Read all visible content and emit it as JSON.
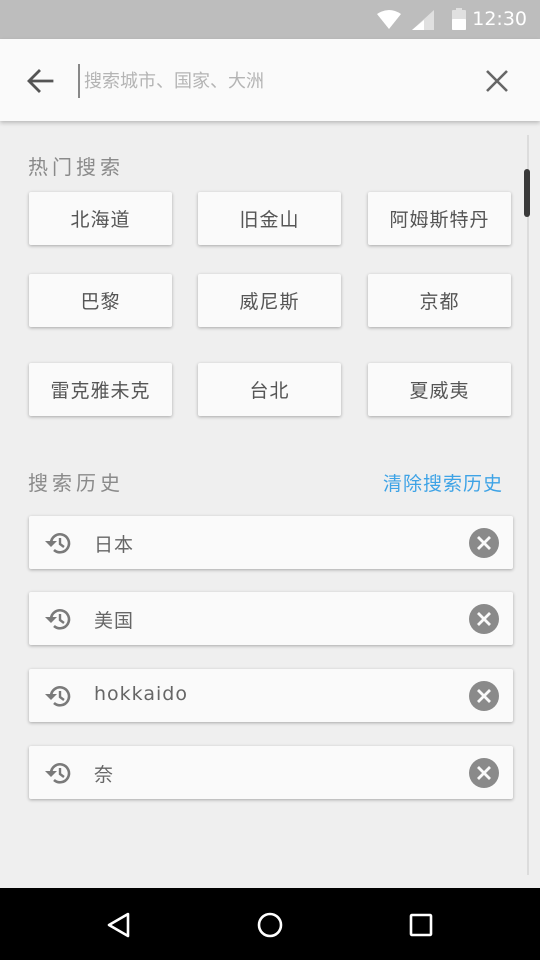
{
  "status_bar": {
    "time": "12:30",
    "icons": [
      "wifi-icon",
      "signal-icon",
      "battery-icon"
    ]
  },
  "search": {
    "placeholder": "搜索城市、国家、大洲",
    "value": "",
    "back_icon": "arrow-back-icon",
    "clear_icon": "close-icon"
  },
  "hot": {
    "title": "热门搜索",
    "items": [
      "北海道",
      "旧金山",
      "阿姆斯特丹",
      "巴黎",
      "威尼斯",
      "京都",
      "雷克雅未克",
      "台北",
      "夏威夷"
    ]
  },
  "history": {
    "title": "搜索历史",
    "clear_label": "清除搜索历史",
    "items": [
      "日本",
      "美国",
      "hokkaido",
      "奈"
    ],
    "item_icon": "history-icon",
    "delete_icon": "remove-circle-icon"
  },
  "colors": {
    "accent": "#3ea3e6",
    "status_bar": "#bdbdbd",
    "background": "#efefef",
    "card": "#fafafa"
  },
  "nav_bar": {
    "buttons": [
      "back-triangle-icon",
      "home-circle-icon",
      "recents-square-icon"
    ]
  }
}
